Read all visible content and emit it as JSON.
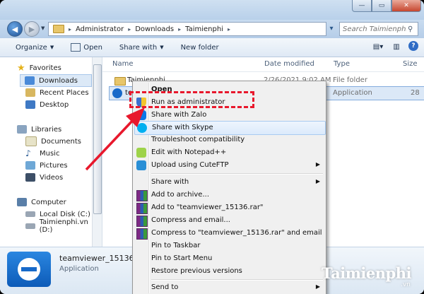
{
  "window": {
    "minimize": "—",
    "maximize": "▭",
    "close": "✕"
  },
  "address": {
    "segments": [
      "Administrator",
      "Downloads",
      "Taimienphi"
    ],
    "search_placeholder": "Search Taimienphi"
  },
  "toolbar": {
    "organize": "Organize",
    "open": "Open",
    "share_with": "Share with",
    "new_folder": "New folder",
    "help": "?"
  },
  "sidebar": {
    "favorites": "Favorites",
    "downloads": "Downloads",
    "recent_places": "Recent Places",
    "desktop": "Desktop",
    "libraries": "Libraries",
    "documents": "Documents",
    "music": "Music",
    "pictures": "Pictures",
    "videos": "Videos",
    "computer": "Computer",
    "local_disk": "Local Disk (C:)",
    "taimienphi_drive": "Taimienphi.vn (D:)"
  },
  "columns": {
    "name": "Name",
    "date_modified": "Date modified",
    "type": "Type",
    "size": "Size"
  },
  "files": [
    {
      "name": "Taimienphi",
      "date": "2/26/2021 9:02 AM",
      "type": "File folder",
      "size": ""
    },
    {
      "name": "te",
      "date": "",
      "type": "Application",
      "size": "28"
    }
  ],
  "details": {
    "name": "teamviewer_15136.exe",
    "type": "Application"
  },
  "context_menu": {
    "items": [
      {
        "label": "Open",
        "icon": "none",
        "submenu": false
      },
      {
        "label": "Run as administrator",
        "icon": "uac-shield-icon",
        "submenu": false
      },
      {
        "label": "Share with Zalo",
        "icon": "zalo-icon",
        "submenu": false
      },
      {
        "label": "Share with Skype",
        "icon": "skype-icon",
        "submenu": false
      },
      {
        "label": "Troubleshoot compatibility",
        "icon": "none",
        "submenu": false
      },
      {
        "label": "Edit with Notepad++",
        "icon": "notepad-plus-plus-icon",
        "submenu": false
      },
      {
        "label": "Upload using CuteFTP",
        "icon": "cuteftp-icon",
        "submenu": true
      },
      {
        "label": "Share with",
        "icon": "none",
        "submenu": true
      },
      {
        "label": "Add to archive...",
        "icon": "winrar-icon",
        "submenu": false
      },
      {
        "label": "Add to \"teamviewer_15136.rar\"",
        "icon": "winrar-icon",
        "submenu": false
      },
      {
        "label": "Compress and email...",
        "icon": "winrar-icon",
        "submenu": false
      },
      {
        "label": "Compress to \"teamviewer_15136.rar\" and email",
        "icon": "winrar-icon",
        "submenu": false
      },
      {
        "label": "Pin to Taskbar",
        "icon": "none",
        "submenu": false
      },
      {
        "label": "Pin to Start Menu",
        "icon": "none",
        "submenu": false
      },
      {
        "label": "Restore previous versions",
        "icon": "none",
        "submenu": false
      },
      {
        "label": "Send to",
        "icon": "none",
        "submenu": true
      }
    ],
    "submenu_arrow": "▶"
  },
  "watermark": {
    "brand": "Taimienphi",
    "domain": ".vn"
  },
  "colors": {
    "highlight": "#dceafc",
    "annotation_red": "#e8182c",
    "teamviewer_blue": "#0e5fbf"
  }
}
